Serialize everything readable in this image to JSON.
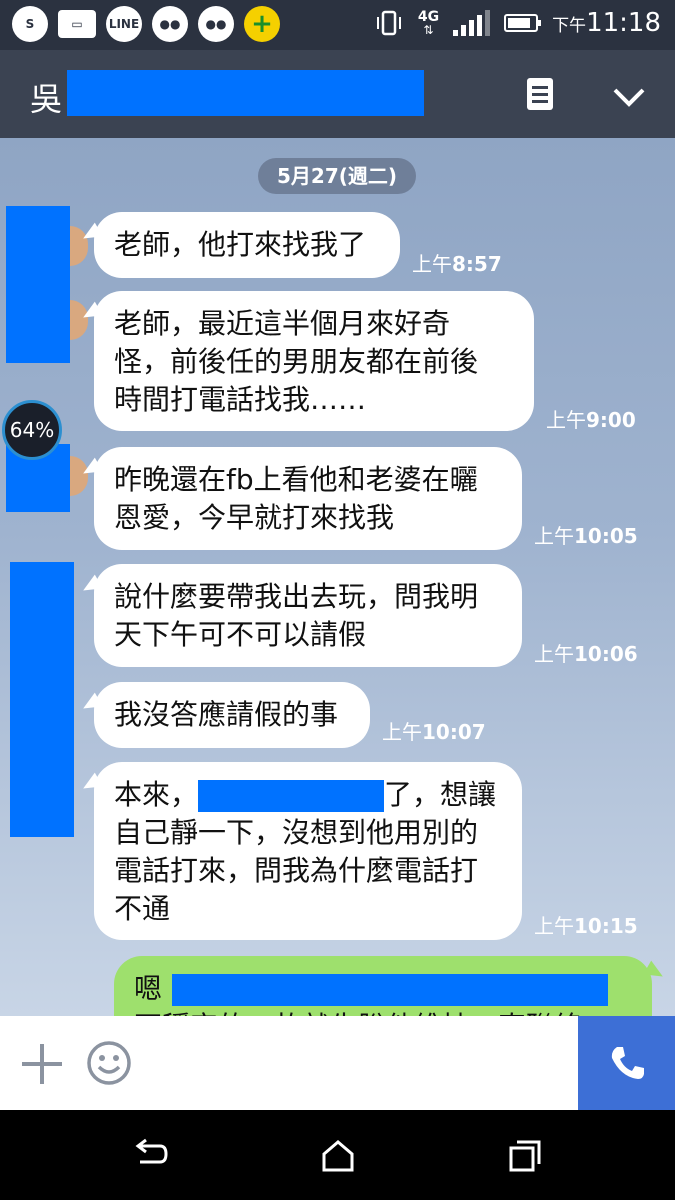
{
  "status_bar": {
    "time_prefix": "下午",
    "time": "11:18",
    "network": "4G",
    "signal_level": 0.8,
    "battery_level": 0.85,
    "icons": [
      "skype-icon",
      "gallery-icon",
      "line-icon",
      "wechat-icon",
      "wechat-icon",
      "plus-app-icon"
    ]
  },
  "header": {
    "title": "吳"
  },
  "chat": {
    "date": "5月27(週二)",
    "messages": [
      {
        "lines": [
          "老師，他打來找我了"
        ],
        "ampm": "上午",
        "time": "8:57"
      },
      {
        "lines": [
          "老師，最近這半個月來好奇",
          "怪，前後任的男朋友都在前後",
          "時間打電話找我……"
        ],
        "ampm": "上午",
        "time": "9:00"
      },
      {
        "lines": [
          "昨晚還在fb上看他和老婆在曬",
          "恩愛，今早就打來找我"
        ],
        "ampm": "上午",
        "time": "10:05"
      },
      {
        "lines": [
          "說什麼要帶我出去玩，問我明",
          "天下午可不可以請假"
        ],
        "ampm": "上午",
        "time": "10:06"
      },
      {
        "lines": [
          "我沒答應請假的事"
        ],
        "ampm": "上午",
        "time": "10:07"
      },
      {
        "lines": [
          "本來，",
          "了，想讓",
          "自己靜一下，沒想到他用別的",
          "電話打來，問我為什麼電話打",
          "不通"
        ],
        "ampm": "上午",
        "time": "10:15"
      },
      {
        "lines": [
          "嗯",
          "不穩定的，故就先脫他維持一直聯絡"
        ]
      }
    ],
    "overlay_badge": "64%"
  },
  "colors": {
    "header_bg": "#3b4352",
    "status_bg": "#2b3240",
    "redaction": "#0072ff",
    "outgoing_bubble": "#9ee06d",
    "call_button": "#3d6fd6"
  }
}
